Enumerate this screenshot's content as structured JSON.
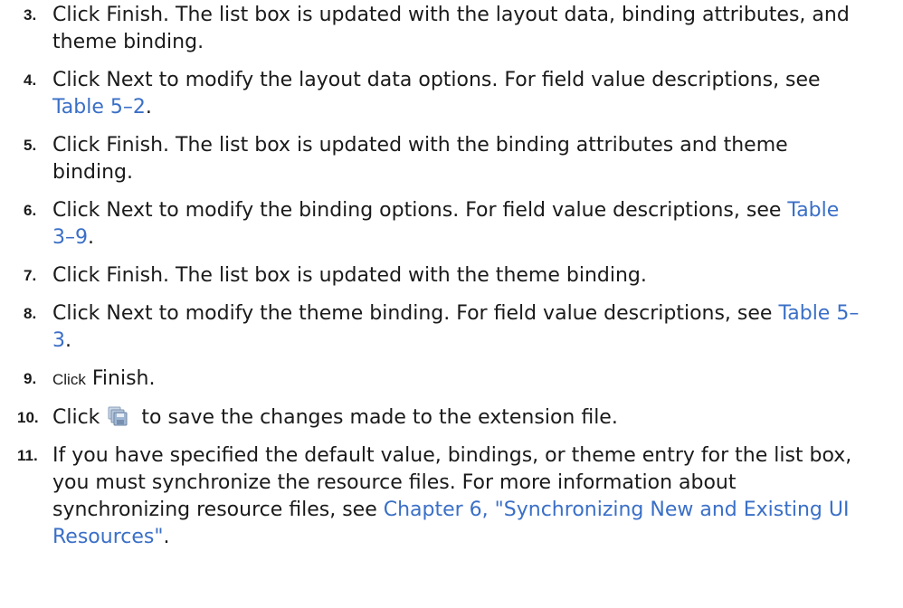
{
  "steps": [
    {
      "number": "3.",
      "text": "Click Finish. The list box is updated with the layout data, binding attributes, and theme binding."
    },
    {
      "number": "4.",
      "text": "Click Next to modify the layout data options. For field value descriptions, see ",
      "link": "Table 5–2",
      "after": "."
    },
    {
      "number": "5.",
      "text": "Click Finish. The list box is updated with the binding attributes and theme binding."
    },
    {
      "number": "6.",
      "text": "Click Next to modify the binding options. For field value descriptions, see ",
      "link": "Table 3–9",
      "after": "."
    },
    {
      "number": "7.",
      "text": "Click Finish. The list box is updated with the theme binding."
    },
    {
      "number": "8.",
      "text": "Click Next to modify the theme binding. For field value descriptions, see ",
      "link": "Table 5–3",
      "after": "."
    },
    {
      "number": "9.",
      "click": "Click",
      "text": "Finish."
    },
    {
      "number": "10.",
      "before": "Click",
      "icon": "save-all-icon",
      "text": "to save the changes made to the extension file."
    },
    {
      "number": "11.",
      "text": "If you have specified the default value, bindings, or theme entry for the list box, you must synchronize the resource files. For more information about synchronizing resource files, see ",
      "link": "Chapter 6, \"Synchronizing New and Existing UI Resources\"",
      "after": "."
    }
  ],
  "colors": {
    "text": "#1a1a1a",
    "link": "#3a6fc7"
  }
}
